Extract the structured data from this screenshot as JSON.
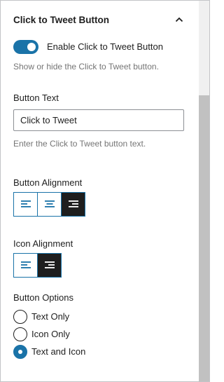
{
  "panel": {
    "title": "Click to Tweet Button",
    "collapse_icon": "chevron-up-icon"
  },
  "enable_toggle": {
    "label": "Enable Click to Tweet Button",
    "checked": true,
    "help": "Show or hide the Click to Tweet button."
  },
  "button_text": {
    "label": "Button Text",
    "value": "Click to Tweet",
    "help": "Enter the Click to Tweet button text."
  },
  "button_alignment": {
    "label": "Button Alignment",
    "options": [
      {
        "icon": "align-left-icon",
        "active": false
      },
      {
        "icon": "align-center-icon",
        "active": false
      },
      {
        "icon": "align-right-icon",
        "active": true
      }
    ]
  },
  "icon_alignment": {
    "label": "Icon Alignment",
    "options": [
      {
        "icon": "align-left-icon",
        "active": false
      },
      {
        "icon": "align-right-icon",
        "active": true
      }
    ]
  },
  "button_options": {
    "label": "Button Options",
    "options": [
      {
        "label": "Text Only",
        "checked": false
      },
      {
        "label": "Icon Only",
        "checked": false
      },
      {
        "label": "Text and Icon",
        "checked": true
      }
    ]
  },
  "colors": {
    "accent": "#1a73a8",
    "active_button_bg": "#1e1e1e",
    "help_text": "#757575"
  }
}
